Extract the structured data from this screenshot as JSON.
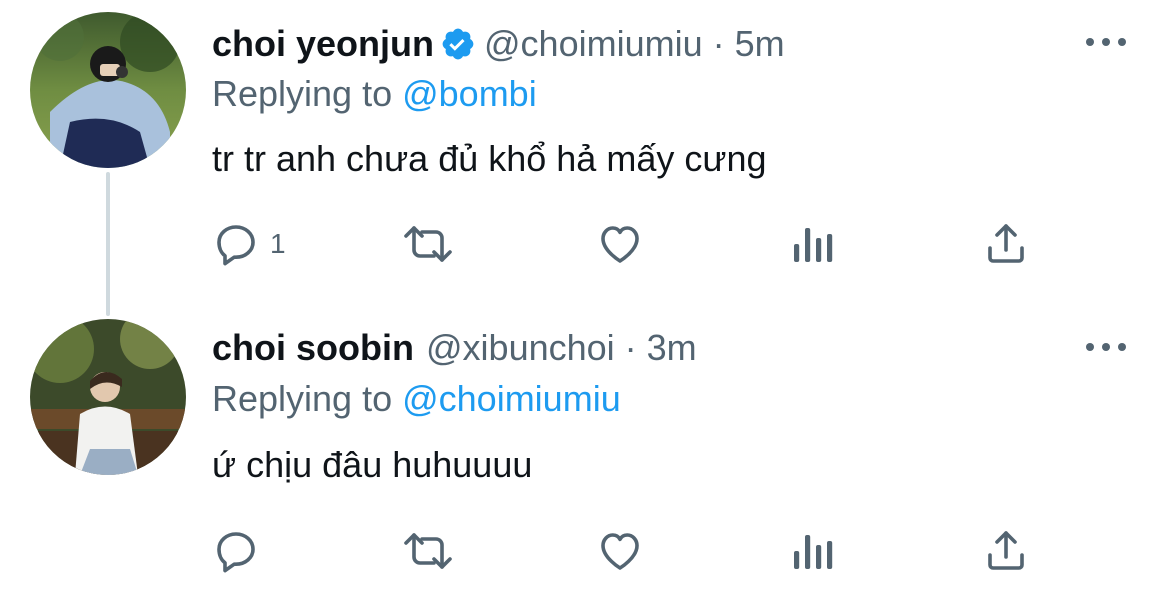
{
  "colors": {
    "text": "#0f1419",
    "secondary": "#536471",
    "link": "#1d9bf0",
    "verified": "#1d9bf0",
    "thread_line": "#cfd9de"
  },
  "tweets": [
    {
      "display_name": "choi yeonjun",
      "verified": true,
      "handle": "@choimiumiu",
      "separator": "·",
      "time": "5m",
      "replying_prefix": "Replying to ",
      "replying_to": "@bombi",
      "text": "tr tr anh chưa đủ khổ hả mấy cưng",
      "reply_count": "1",
      "icons": [
        "reply-icon",
        "retweet-icon",
        "like-icon",
        "views-icon",
        "share-icon"
      ]
    },
    {
      "display_name": "choi soobin",
      "verified": false,
      "handle": "@xibunchoi",
      "separator": "·",
      "time": "3m",
      "replying_prefix": "Replying to ",
      "replying_to": "@choimiumiu",
      "text": "ứ chịu đâu huhuuuu",
      "reply_count": "",
      "icons": [
        "reply-icon",
        "retweet-icon",
        "like-icon",
        "views-icon",
        "share-icon"
      ]
    }
  ]
}
